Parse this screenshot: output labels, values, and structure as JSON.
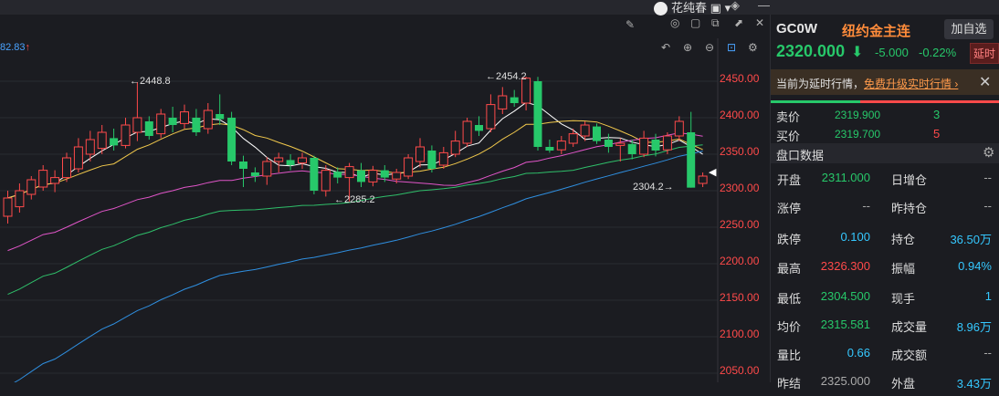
{
  "topbar": {
    "user_name": "花纯春"
  },
  "chart": {
    "ma_value": "82.83",
    "y_ticks": [
      "2450.00",
      "2400.00",
      "2350.00",
      "2300.00",
      "2250.00",
      "2200.00",
      "2150.00",
      "2100.00",
      "2050.00"
    ],
    "annotations": {
      "high1": "2448.8",
      "high2": "2454.2",
      "low1": "2285.2",
      "low2": "2304.2"
    }
  },
  "chart_data": {
    "type": "candlestick",
    "ylim": [
      2040,
      2480
    ],
    "y_ticks": [
      2450,
      2400,
      2350,
      2300,
      2250,
      2200,
      2150,
      2100,
      2050
    ],
    "candles": [
      [
        2265,
        2290,
        2255,
        2300
      ],
      [
        2278,
        2300,
        2270,
        2310
      ],
      [
        2295,
        2315,
        2288,
        2320
      ],
      [
        2305,
        2328,
        2300,
        2335
      ],
      [
        2310,
        2318,
        2298,
        2328
      ],
      [
        2318,
        2345,
        2312,
        2352
      ],
      [
        2330,
        2360,
        2325,
        2372
      ],
      [
        2350,
        2370,
        2340,
        2382
      ],
      [
        2358,
        2380,
        2350,
        2390
      ],
      [
        2372,
        2362,
        2355,
        2385
      ],
      [
        2362,
        2390,
        2358,
        2400
      ],
      [
        2380,
        2400,
        2368,
        2448.8
      ],
      [
        2395,
        2375,
        2370,
        2402
      ],
      [
        2378,
        2405,
        2372,
        2412
      ],
      [
        2400,
        2390,
        2380,
        2415
      ],
      [
        2392,
        2408,
        2385,
        2418
      ],
      [
        2400,
        2380,
        2375,
        2412
      ],
      [
        2385,
        2410,
        2378,
        2420
      ],
      [
        2405,
        2398,
        2390,
        2432
      ],
      [
        2400,
        2340,
        2335,
        2408
      ],
      [
        2340,
        2330,
        2305,
        2348
      ],
      [
        2325,
        2320,
        2312,
        2332
      ],
      [
        2320,
        2340,
        2308,
        2346
      ],
      [
        2340,
        2345,
        2325,
        2352
      ],
      [
        2342,
        2335,
        2328,
        2350
      ],
      [
        2338,
        2345,
        2330,
        2352
      ],
      [
        2345,
        2300,
        2295,
        2348
      ],
      [
        2300,
        2328,
        2292,
        2335
      ],
      [
        2326,
        2318,
        2310,
        2332
      ],
      [
        2318,
        2333,
        2285.2,
        2338
      ],
      [
        2328,
        2312,
        2305,
        2338
      ],
      [
        2312,
        2328,
        2306,
        2334
      ],
      [
        2328,
        2318,
        2312,
        2335
      ],
      [
        2316,
        2325,
        2310,
        2330
      ],
      [
        2320,
        2345,
        2316,
        2350
      ],
      [
        2340,
        2360,
        2332,
        2372
      ],
      [
        2355,
        2330,
        2325,
        2362
      ],
      [
        2335,
        2352,
        2330,
        2360
      ],
      [
        2350,
        2368,
        2346,
        2382
      ],
      [
        2365,
        2395,
        2360,
        2400
      ],
      [
        2390,
        2382,
        2375,
        2402
      ],
      [
        2385,
        2418,
        2380,
        2432
      ],
      [
        2412,
        2430,
        2405,
        2442
      ],
      [
        2428,
        2420,
        2415,
        2438
      ],
      [
        2420,
        2454.2,
        2410,
        2456
      ],
      [
        2450,
        2360,
        2355,
        2456
      ],
      [
        2360,
        2355,
        2352,
        2370
      ],
      [
        2356,
        2368,
        2350,
        2375
      ],
      [
        2365,
        2378,
        2360,
        2385
      ],
      [
        2375,
        2390,
        2368,
        2395
      ],
      [
        2388,
        2368,
        2364,
        2392
      ],
      [
        2370,
        2360,
        2352,
        2378
      ],
      [
        2362,
        2365,
        2340,
        2372
      ],
      [
        2364,
        2350,
        2343,
        2370
      ],
      [
        2350,
        2372,
        2346,
        2382
      ],
      [
        2370,
        2355,
        2347,
        2378
      ],
      [
        2356,
        2375,
        2350,
        2380
      ],
      [
        2375,
        2395,
        2368,
        2402
      ],
      [
        2380,
        2304.2,
        2304.2,
        2408
      ],
      [
        2310,
        2320,
        2305,
        2325
      ]
    ]
  },
  "side": {
    "code": "GC0W",
    "name": "纽约金主连",
    "add_label": "加自选",
    "price": "2320.000",
    "change": "-5.000",
    "change_pct": "-0.22%",
    "delay_badge": "延时",
    "notice_text": "当前为延时行情，",
    "notice_link": "免费升级实时行情",
    "ask_label": "卖价",
    "ask_price": "2319.900",
    "ask_vol": "3",
    "bid_label": "买价",
    "bid_price": "2319.700",
    "bid_vol": "5",
    "section_title": "盘口数据",
    "rows": [
      {
        "l": "开盘",
        "v": "2311.000",
        "l2": "日增仓",
        "v2": "--"
      },
      {
        "l": "涨停",
        "v": "--",
        "l2": "昨持仓",
        "v2": "--"
      },
      {
        "l": "跌停",
        "v": "0.100",
        "l2": "持仓",
        "v2": "36.50万"
      },
      {
        "l": "最高",
        "v": "2326.300",
        "l2": "振幅",
        "v2": "0.94%"
      },
      {
        "l": "最低",
        "v": "2304.500",
        "l2": "现手",
        "v2": "1"
      },
      {
        "l": "均价",
        "v": "2315.581",
        "l2": "成交量",
        "v2": "8.96万"
      },
      {
        "l": "量比",
        "v": "0.66",
        "l2": "成交额",
        "v2": "--"
      },
      {
        "l": "昨结",
        "v": "2325.000",
        "l2": "外盘",
        "v2": "3.43万"
      }
    ]
  }
}
